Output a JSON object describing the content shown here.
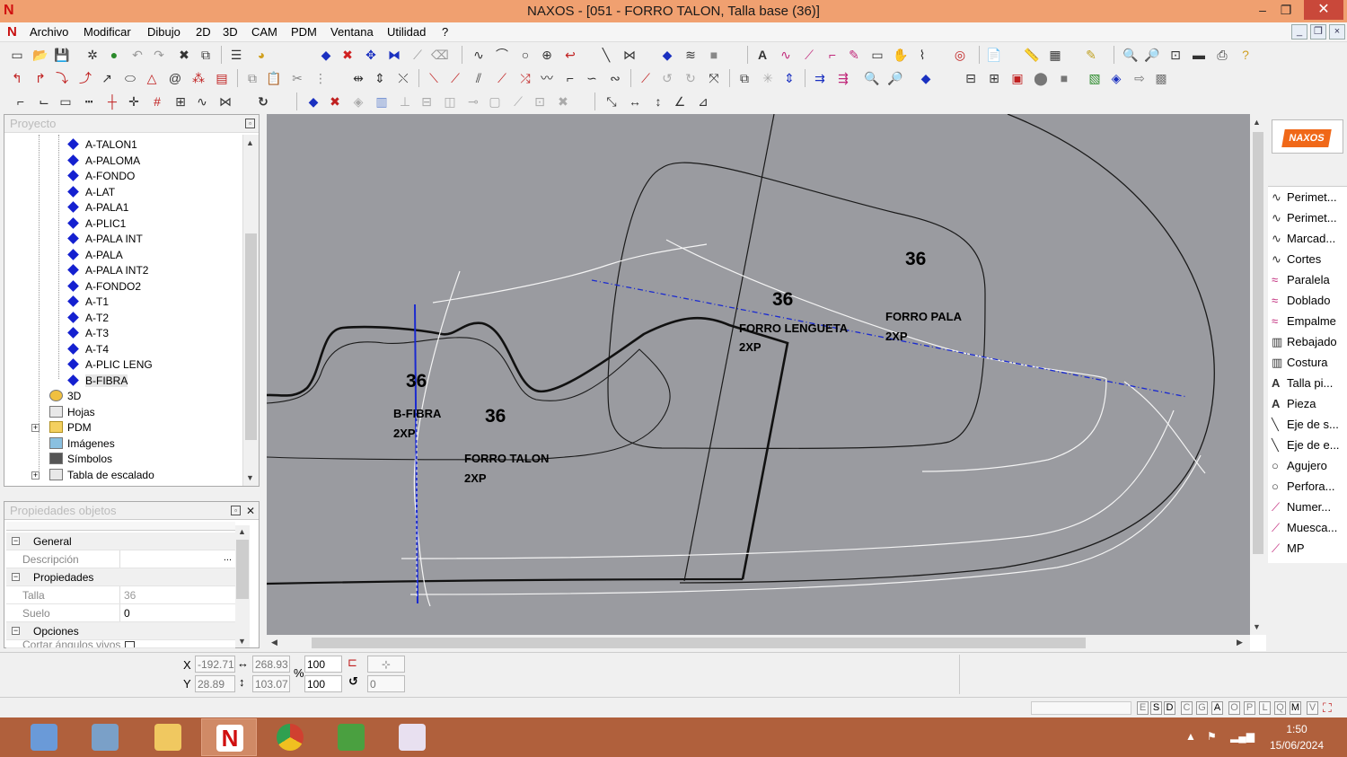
{
  "window": {
    "title": "NAXOS - [051 - FORRO TALON, Talla base (36)]",
    "min_label": "–",
    "max_label": "❐",
    "close_label": "✕"
  },
  "menu": {
    "items": [
      "Archivo",
      "Modificar",
      "Dibujo",
      "2D",
      "3D",
      "CAM",
      "PDM",
      "Ventana",
      "Utilidad",
      "?"
    ]
  },
  "project_panel": {
    "header": "Proyecto",
    "pieces": [
      "A-TALON1",
      "A-PALOMA",
      "A-FONDO",
      "A-LAT",
      "A-PALA1",
      "A-PLIC1",
      "A-PALA INT",
      "A-PALA",
      "A-PALA INT2",
      "A-FONDO2",
      "A-T1",
      "A-T2",
      "A-T3",
      "A-T4",
      "A-PLIC LENG",
      "B-FIBRA"
    ],
    "selected": "B-FIBRA",
    "folders": [
      "3D",
      "Hojas",
      "PDM",
      "Imágenes",
      "Símbolos",
      "Tabla de escalado"
    ]
  },
  "properties_panel": {
    "header": "Propiedades objetos",
    "group_general": "General",
    "descripcion_label": "Descripción",
    "descripcion_btn": "...",
    "group_propiedades": "Propiedades",
    "talla_label": "Talla",
    "talla_value": "36",
    "suelo_label": "Suelo",
    "suelo_value": "0",
    "group_opciones": "Opciones",
    "cortar_label": "Cortar ángulos vivos"
  },
  "canvas": {
    "labels": {
      "size_a": "36",
      "size_b": "36",
      "size_c": "36",
      "size_d": "36",
      "forro_pala": "FORRO PALA",
      "forro_pala_qty": "2XP",
      "forro_lengueta": "FORRO LENGUETA",
      "forro_lengueta_qty": "2XP",
      "b_fibra": "B-FIBRA",
      "b_fibra_qty": "2XP",
      "forro_talon": "FORRO TALON",
      "forro_talon_qty": "2XP"
    }
  },
  "commands": {
    "items": [
      {
        "icon": "wave-icon",
        "label": "Perimet..."
      },
      {
        "icon": "wave-icon",
        "label": "Perimet..."
      },
      {
        "icon": "wave-icon",
        "label": "Marcad..."
      },
      {
        "icon": "wave-icon",
        "label": "Cortes"
      },
      {
        "icon": "parallel-icon",
        "label": "Paralela"
      },
      {
        "icon": "fold-icon",
        "label": "Doblado"
      },
      {
        "icon": "join-icon",
        "label": "Empalme"
      },
      {
        "icon": "skive-icon",
        "label": "Rebajado"
      },
      {
        "icon": "stitch-icon",
        "label": "Costura"
      },
      {
        "icon": "text-icon",
        "label": "Talla pi..."
      },
      {
        "icon": "text-icon",
        "label": "Pieza"
      },
      {
        "icon": "axis-icon",
        "label": "Eje de s..."
      },
      {
        "icon": "axis-icon",
        "label": "Eje de e..."
      },
      {
        "icon": "hole-icon",
        "label": "Agujero"
      },
      {
        "icon": "hole-icon",
        "label": "Perfora..."
      },
      {
        "icon": "pen-icon",
        "label": "Numer..."
      },
      {
        "icon": "pen-icon",
        "label": "Muesca..."
      },
      {
        "icon": "pen-icon",
        "label": "MP"
      }
    ]
  },
  "coords": {
    "x_label": "X",
    "y_label": "Y",
    "x_value": "-192.71",
    "y_value": "28.89",
    "width_value": "268.93",
    "height_value": "103.07",
    "scale_x": "100",
    "scale_y": "100",
    "percent": "%",
    "rotation": "0"
  },
  "status_letters": [
    "E",
    "S",
    "D",
    "C",
    "G",
    "A",
    "O",
    "P",
    "L",
    "Q",
    "M",
    "V"
  ],
  "status_active": [
    "S",
    "D",
    "A",
    "M"
  ],
  "taskbar": {
    "time": "1:50",
    "date": "15/06/2024"
  }
}
